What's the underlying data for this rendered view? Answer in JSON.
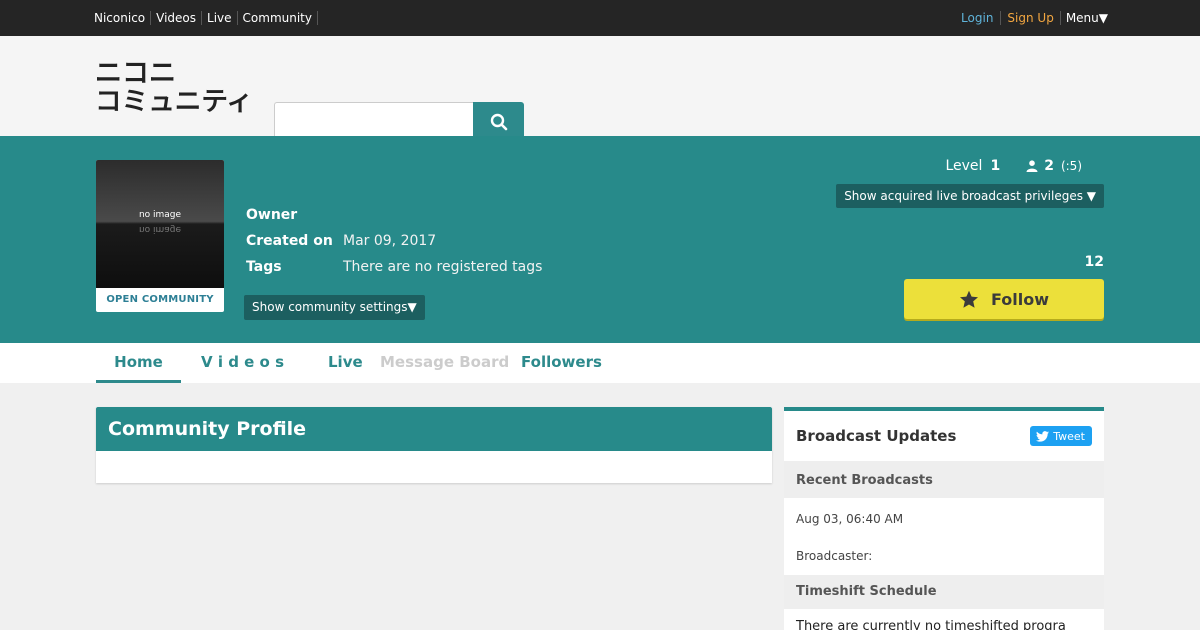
{
  "topnav": {
    "links": [
      "Niconico",
      "Videos",
      "Live",
      "Community"
    ],
    "login": "Login",
    "signup": "Sign Up",
    "menu": "Menu▼"
  },
  "logo": {
    "line1": "ニコニ",
    "line2": "コミュニティ"
  },
  "search": {
    "value": "",
    "icon": "search-icon"
  },
  "community": {
    "thumbnail": {
      "no_image": "no image",
      "label": "OPEN COMMUNITY"
    },
    "owner_label": "Owner",
    "created_label": "Created on",
    "created_value": "Mar 09, 2017",
    "tags_label": "Tags",
    "tags_value": "There are no registered tags",
    "settings_button": "Show community settings▼",
    "level_label": "Level",
    "level_value": "1",
    "member_icon": "member-icon",
    "member_count": "2",
    "member_max": "(:5)",
    "privileges_button": "Show acquired live broadcast privileges ▼",
    "follower_count": "12",
    "follow_button": "Follow",
    "follow_icon": "star-icon"
  },
  "tabs": [
    {
      "label": "Home",
      "active": true
    },
    {
      "label": "V i d e o s",
      "active": false
    },
    {
      "label": "Live",
      "active": false
    },
    {
      "label": "Message Board",
      "disabled": true
    },
    {
      "label": "Followers",
      "active": false
    }
  ],
  "profile": {
    "title": "Community Profile"
  },
  "sidebar": {
    "title": "Broadcast Updates",
    "tweet": "Tweet",
    "recent_title": "Recent Broadcasts",
    "recent_date": "Aug 03, 06:40 AM",
    "broadcaster_label": "Broadcaster:",
    "timeshift_title": "Timeshift Schedule",
    "timeshift_text": "There are currently no timeshifted progra"
  },
  "colors": {
    "teal": "#278a8a",
    "follow_yellow": "#ece03a",
    "topbar": "#252525",
    "twitter": "#1da1f2"
  }
}
